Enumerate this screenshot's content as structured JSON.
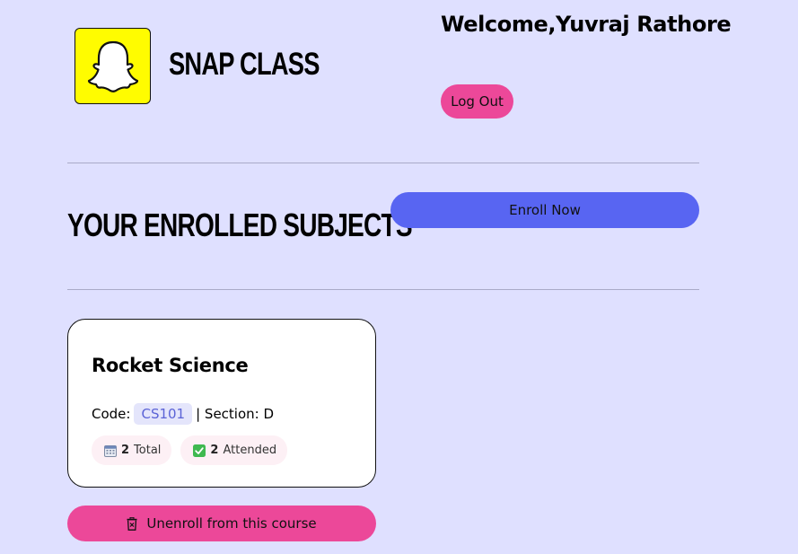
{
  "header": {
    "brand": "SNAP CLASS",
    "logo_icon": "ghost-icon",
    "welcome": "Welcome,Yuvraj Rathore",
    "logout_label": "Log Out"
  },
  "section": {
    "title": "YOUR ENROLLED SUBJECTS",
    "enroll_label": "Enroll Now"
  },
  "courses": [
    {
      "name": "Rocket Science",
      "code_label": "Code:",
      "code": "CS101",
      "section_text": "| Section: D",
      "total_count": "2",
      "total_label": "Total",
      "total_icon": "calendar-icon",
      "attended_count": "2",
      "attended_label": "Attended",
      "attended_icon": "checkmark-icon",
      "unenroll_label": "Unenroll from this course",
      "unenroll_icon": "trash-icon"
    }
  ],
  "colors": {
    "background": "#dfe0ff",
    "logo_yellow": "#fffc00",
    "pink": "#ec4899",
    "indigo": "#5865f2",
    "badge_bg": "#e4e5fb",
    "badge_text": "#5b63d6",
    "stat_bg": "#fdf0f5"
  }
}
